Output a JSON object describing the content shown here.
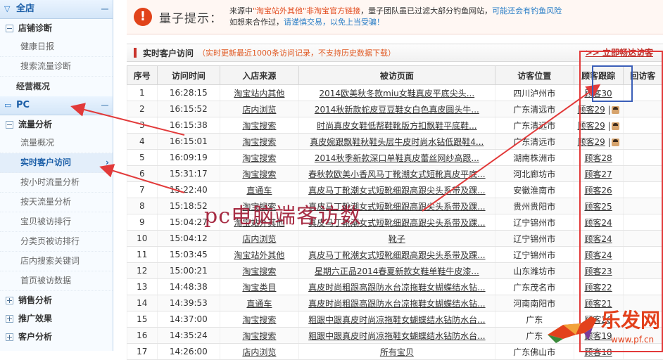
{
  "sidebar": {
    "shop_label": "全店",
    "shop_sections": [
      {
        "label": "店铺诊断",
        "items": [
          "健康日报",
          "搜索流量诊断"
        ]
      }
    ],
    "overview_label": "经营概况",
    "pc_label": "PC",
    "pc_section": {
      "label": "流量分析",
      "items": [
        "流量概况",
        "实时客户访问",
        "按小时流量分析",
        "按天流量分析",
        "宝贝被访排行",
        "分类页被访排行",
        "店内搜索关键词",
        "首页被访数据"
      ],
      "active_index": 1
    },
    "more_sections": [
      "销售分析",
      "推广效果",
      "客户分析"
    ]
  },
  "notice": {
    "title": "量子提示：",
    "line1_prefix": "来源中",
    "line1_red": "\"淘宝站外其他\"非淘宝官方链接",
    "line1_mid": "，量子团队虽已过滤大部分钓鱼网站，",
    "line1_blue": "可能还会有钓鱼风险",
    "line2_prefix": "如想来合作过，",
    "line2_blue": "请谨慎交易，以免上当受骗！"
  },
  "panel": {
    "title": "实时客户访问",
    "subtitle": "（实时更新最近1000条访问记录，不支持历史数据下载）",
    "right_link": ">> 立即畅达访客"
  },
  "table": {
    "headers": [
      "序号",
      "访问时间",
      "入店来源",
      "被访页面",
      "访客位置",
      "顾客跟踪",
      "回访客"
    ],
    "rows": [
      {
        "no": "1",
        "time": "16:28:15",
        "source": "淘宝站内其他",
        "page": "2014欧美秋冬款miu女鞋真皮平底尖头...",
        "loc": "四川泸州市",
        "visitor": "顾客30",
        "avatar": false
      },
      {
        "no": "2",
        "time": "16:15:52",
        "source": "店内浏览",
        "page": "2014秋新款蛇皮豆豆鞋女白色真皮圆头牛...",
        "loc": "广东清远市",
        "visitor": "顾客29",
        "avatar": true
      },
      {
        "no": "3",
        "time": "16:15:38",
        "source": "淘宝搜索",
        "page": "时尚真皮女鞋低帮鞋靴版方扣飘鞋平底鞋...",
        "loc": "广东清远市",
        "visitor": "顾客29",
        "avatar": true
      },
      {
        "no": "4",
        "time": "16:15:01",
        "source": "淘宝搜索",
        "page": "真皮婉跟飘鞋秋鞋头层牛皮时尚水钻低跟鞋4...",
        "loc": "广东清远市",
        "visitor": "顾客29",
        "avatar": true
      },
      {
        "no": "5",
        "time": "16:09:19",
        "source": "淘宝搜索",
        "page": "2014秋季新款深口单鞋真皮蕾丝网纱高跟...",
        "loc": "湖南株洲市",
        "visitor": "顾客28",
        "avatar": false
      },
      {
        "no": "6",
        "time": "15:31:17",
        "source": "淘宝搜索",
        "page": "春秋款欧美小香风马丁靴潮女式短靴真皮平底...",
        "loc": "河北廊坊市",
        "visitor": "顾客27",
        "avatar": false
      },
      {
        "no": "7",
        "time": "15:22:40",
        "source": "直通车",
        "page": "真皮马丁靴潮女式短靴细跟高跟尖头系带及踝...",
        "loc": "安徽淮南市",
        "visitor": "顾客26",
        "avatar": false
      },
      {
        "no": "8",
        "time": "15:18:52",
        "source": "淘宝搜索",
        "page": "真皮马丁靴潮女式短靴细跟高跟尖头系带及踝...",
        "loc": "贵州贵阳市",
        "visitor": "顾客25",
        "avatar": false
      },
      {
        "no": "9",
        "time": "15:04:27",
        "source": "淘宝站外其他",
        "page": "真皮马丁靴潮女式短靴细跟高跟尖头系带及踝...",
        "loc": "辽宁锦州市",
        "visitor": "顾客24",
        "avatar": false
      },
      {
        "no": "10",
        "time": "15:04:12",
        "source": "店内浏览",
        "page": "靴子",
        "loc": "辽宁锦州市",
        "visitor": "顾客24",
        "avatar": false
      },
      {
        "no": "11",
        "time": "15:03:45",
        "source": "淘宝站外其他",
        "page": "真皮马丁靴潮女式短靴细跟高跟尖头系带及踝...",
        "loc": "辽宁锦州市",
        "visitor": "顾客24",
        "avatar": false
      },
      {
        "no": "12",
        "time": "15:00:21",
        "source": "淘宝搜索",
        "page": "星期六正品2014春夏新款女鞋单鞋牛皮漆...",
        "loc": "山东潍坊市",
        "visitor": "顾客23",
        "avatar": false
      },
      {
        "no": "13",
        "time": "14:48:38",
        "source": "淘宝类目",
        "page": "真皮时尚粗跟高跟防水台凉拖鞋女蝴蝶结水钻...",
        "loc": "广东茂名市",
        "visitor": "顾客22",
        "avatar": false
      },
      {
        "no": "14",
        "time": "14:39:53",
        "source": "直通车",
        "page": "真皮时尚粗跟高跟防水台凉拖鞋女蝴蝶结水钻...",
        "loc": "河南南阳市",
        "visitor": "顾客21",
        "avatar": false
      },
      {
        "no": "15",
        "time": "14:37:00",
        "source": "淘宝搜索",
        "page": "粗跟中跟真皮时尚凉拖鞋女蝴蝶结水钻防水台...",
        "loc": "广东",
        "visitor": "顾客20",
        "avatar": false
      },
      {
        "no": "16",
        "time": "14:35:24",
        "source": "淘宝搜索",
        "page": "粗跟中跟真皮时尚凉拖鞋女蝴蝶结水钻防水台...",
        "loc": "广东",
        "visitor": "顾客19",
        "avatar": false
      },
      {
        "no": "17",
        "time": "14:26:00",
        "source": "店内浏览",
        "page": "所有宝贝",
        "loc": "广东佛山市",
        "visitor": "顾客18",
        "avatar": false
      }
    ]
  },
  "annotation": {
    "text": "pc电脑端客访数",
    "color_red": "#e23a3a",
    "color_blue": "#3b5fb8"
  },
  "watermark": {
    "text": "乐发网",
    "url": "www.pf.cn"
  }
}
